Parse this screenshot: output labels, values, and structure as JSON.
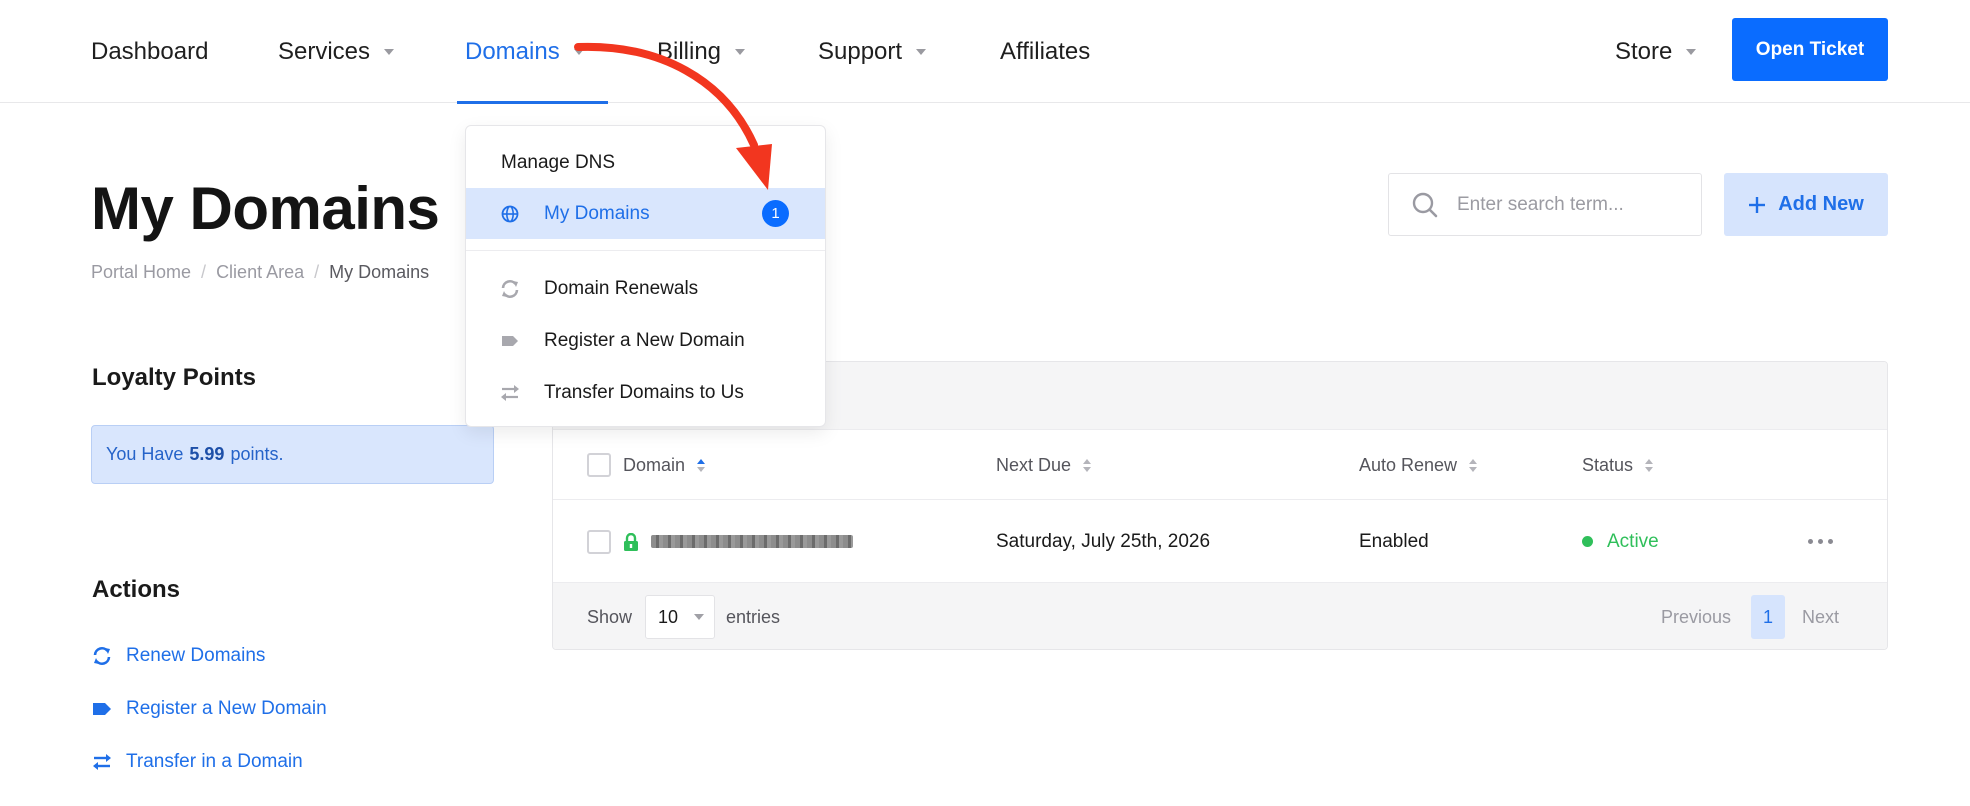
{
  "nav": {
    "items": [
      {
        "label": "Dashboard"
      },
      {
        "label": "Services"
      },
      {
        "label": "Domains"
      },
      {
        "label": "Billing"
      },
      {
        "label": "Support"
      },
      {
        "label": "Affiliates"
      }
    ],
    "store_label": "Store",
    "open_ticket_label": "Open Ticket",
    "accent_color": "#0a6cff"
  },
  "dropdown": {
    "items": [
      {
        "label": "Manage DNS"
      },
      {
        "label": "My Domains",
        "icon": "globe-icon",
        "badge": "1"
      },
      {
        "label": "Domain Renewals",
        "icon": "sync-icon"
      },
      {
        "label": "Register a New Domain",
        "icon": "tag-icon"
      },
      {
        "label": "Transfer Domains to Us",
        "icon": "transfer-icon"
      }
    ]
  },
  "page": {
    "title": "My Domains",
    "breadcrumb": [
      "Portal Home",
      "Client Area",
      "My Domains"
    ],
    "search_placeholder": "Enter search term...",
    "add_new_label": "Add New"
  },
  "sidebar": {
    "loyalty_heading": "Loyalty Points",
    "loyalty_prefix": "You Have",
    "loyalty_points": "5.99",
    "loyalty_suffix": "points.",
    "actions_heading": "Actions",
    "actions": [
      {
        "label": "Renew Domains",
        "icon": "sync-icon"
      },
      {
        "label": "Register a New Domain",
        "icon": "tag-icon"
      },
      {
        "label": "Transfer in a Domain",
        "icon": "transfer-icon"
      }
    ]
  },
  "table": {
    "columns": [
      "Domain",
      "Next Due",
      "Auto Renew",
      "Status"
    ],
    "rows": [
      {
        "domain": "",
        "next_due": "Saturday, July 25th, 2026",
        "auto_renew": "Enabled",
        "status": "Active"
      }
    ],
    "footer": {
      "show_label": "Show",
      "entries_value": "10",
      "entries_label": "entries",
      "previous_label": "Previous",
      "page": "1",
      "next_label": "Next"
    },
    "status_color": "#2fbf5a"
  }
}
